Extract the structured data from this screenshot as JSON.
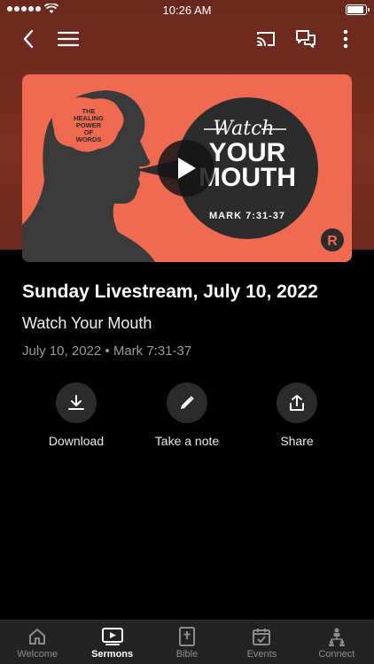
{
  "status_bar": {
    "time": "10:26 AM",
    "battery_level": 0.95
  },
  "nav": {
    "back_icon": "chevron-left-icon",
    "menu_icon": "hamburger-menu-icon",
    "cast_icon": "cast-icon",
    "chat_icon": "chat-bubbles-icon",
    "more_icon": "more-vertical-icon"
  },
  "artwork": {
    "brain_text": [
      "THE",
      "HEALING",
      "POWER",
      "OF",
      "WORDS"
    ],
    "script_title": "Watch",
    "title_line1": "YOUR",
    "title_line2": "MOUTH",
    "reference": "MARK 7:31-37",
    "logo_letter": "R"
  },
  "sermon": {
    "title": "Sunday Livestream, July 10, 2022",
    "subtitle": "Watch Your Mouth",
    "meta": "July 10, 2022 • Mark 7:31-37"
  },
  "actions": [
    {
      "label": "Download",
      "icon": "download-icon"
    },
    {
      "label": "Take a note",
      "icon": "pencil-icon"
    },
    {
      "label": "Share",
      "icon": "share-icon"
    }
  ],
  "tabs": [
    {
      "label": "Welcome",
      "icon": "home-icon"
    },
    {
      "label": "Sermons",
      "icon": "video-play-icon",
      "active": true
    },
    {
      "label": "Bible",
      "icon": "bible-icon"
    },
    {
      "label": "Events",
      "icon": "calendar-icon"
    },
    {
      "label": "Connect",
      "icon": "people-network-icon"
    }
  ],
  "colors": {
    "hero": "#6a281c",
    "artwork": "#f06a52",
    "active_tab": "#ffffff",
    "inactive_tab": "#8c8c8c"
  }
}
